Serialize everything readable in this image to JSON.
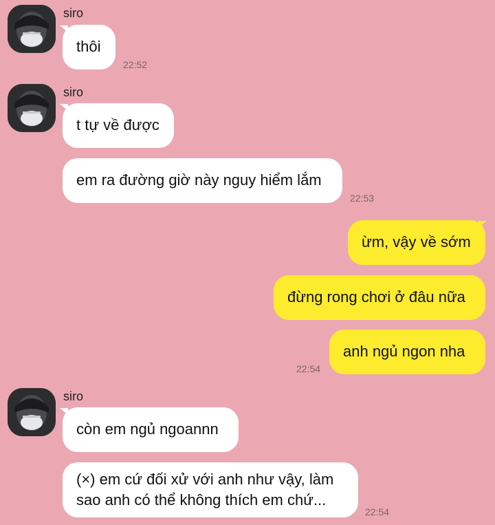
{
  "colors": {
    "background": "#eba8b2",
    "incoming_bubble": "#ffffff",
    "outgoing_bubble": "#fcec2d"
  },
  "contact": {
    "name": "siro",
    "avatar_icon": "user-avatar-icon"
  },
  "messages": [
    {
      "from": "siro",
      "text": "thôi",
      "time": "22:52"
    },
    {
      "from": "siro",
      "text": "t tự về được"
    },
    {
      "from": "siro",
      "text": "em ra đường giờ này nguy hiểm lắm",
      "time": "22:53"
    },
    {
      "from": "me",
      "text": "ừm, vậy về sớm"
    },
    {
      "from": "me",
      "text": "đừng rong chơi ở đâu nữa"
    },
    {
      "from": "me",
      "text": "anh ngủ ngon nha",
      "time": "22:54"
    },
    {
      "from": "siro",
      "text": "còn em ngủ ngoannn"
    },
    {
      "from": "siro",
      "text_lines": [
        "(×) em cứ đối xử với anh như vậy, làm",
        "sao anh có thể không thích em chứ..."
      ],
      "time": "22:54"
    }
  ]
}
